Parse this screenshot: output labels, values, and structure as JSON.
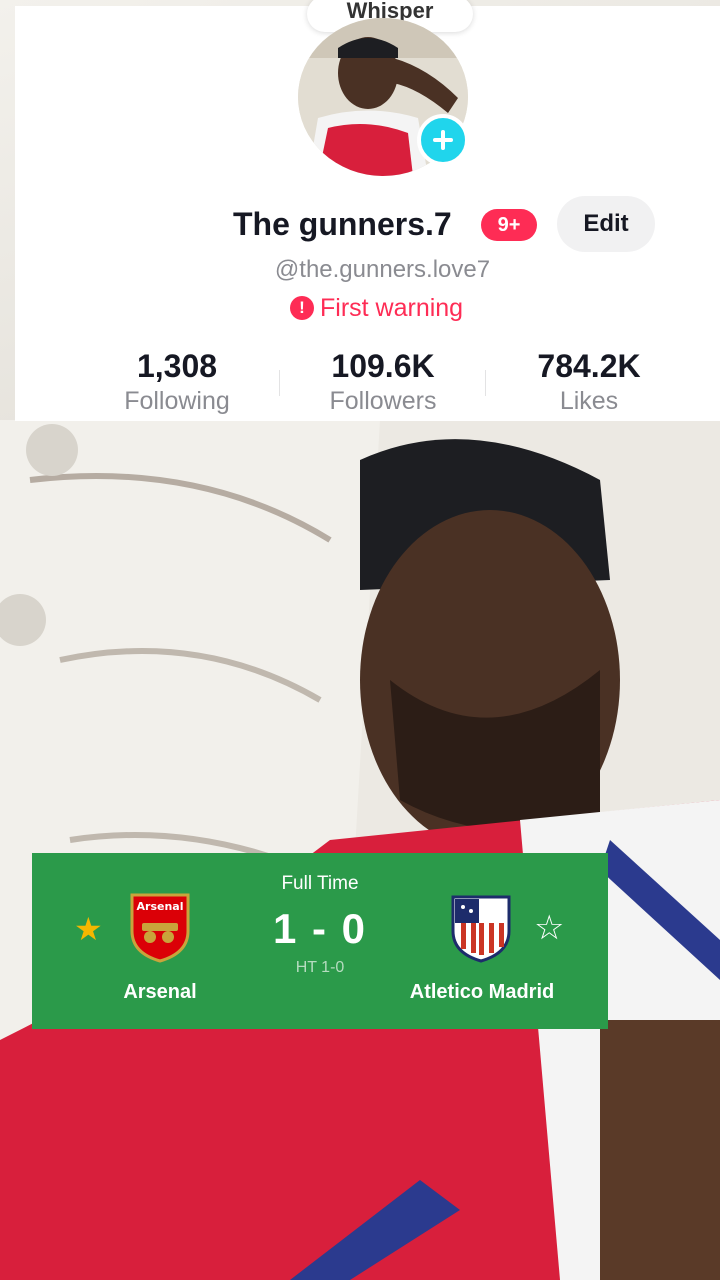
{
  "profile": {
    "whisper_label": "Whisper",
    "display_name": "The  gunners.7",
    "notification_badge": "9+",
    "edit_label": "Edit",
    "username": "@the.gunners.love7",
    "warning_text": "First warning",
    "stats": [
      {
        "value": "1,308",
        "label": "Following"
      },
      {
        "value": "109.6K",
        "label": "Followers"
      },
      {
        "value": "784.2K",
        "label": "Likes"
      }
    ]
  },
  "match": {
    "status": "Full Time",
    "score": "1 - 0",
    "halftime": "HT 1-0",
    "home_team": "Arsenal",
    "away_team": "Atletico Madrid",
    "home_crest_text": "Arsenal"
  },
  "colors": {
    "accent_red": "#fe2c55",
    "follow_blue": "#20d5ec",
    "score_card_green": "#2b9a4a"
  }
}
